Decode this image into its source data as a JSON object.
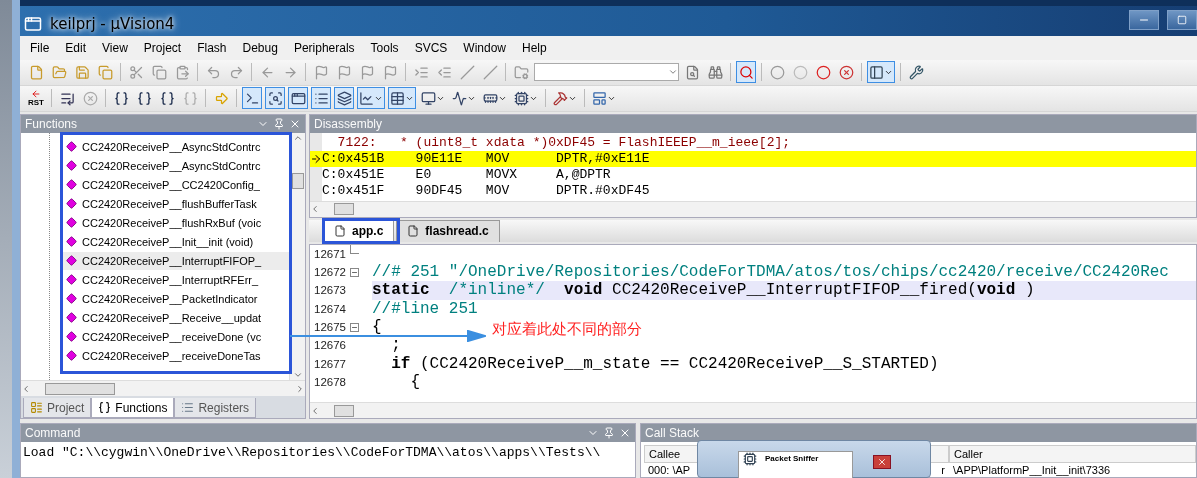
{
  "window": {
    "title": "keilprj  - µVision4"
  },
  "menu": [
    {
      "label": "File"
    },
    {
      "label": "Edit"
    },
    {
      "label": "View"
    },
    {
      "label": "Project"
    },
    {
      "label": "Flash"
    },
    {
      "label": "Debug"
    },
    {
      "label": "Peripherals"
    },
    {
      "label": "Tools"
    },
    {
      "label": "SVCS"
    },
    {
      "label": "Window"
    },
    {
      "label": "Help"
    }
  ],
  "debug_toolbar": {
    "reset_label": "RST",
    "windows": [
      {
        "on": true
      },
      {
        "on": true
      },
      {
        "on": true
      },
      {
        "on": true
      },
      {
        "on": true
      },
      {
        "on": true
      },
      {
        "on": true
      },
      {
        "on": false
      },
      {
        "on": false
      },
      {
        "on": false
      },
      {
        "on": false
      }
    ]
  },
  "functions_panel": {
    "title": "Functions",
    "items": [
      {
        "label": "CC2420ReceiveP__AsyncStdContrc",
        "selected": false
      },
      {
        "label": "CC2420ReceiveP__AsyncStdContrc",
        "selected": false
      },
      {
        "label": "CC2420ReceiveP__CC2420Config_",
        "selected": false
      },
      {
        "label": "CC2420ReceiveP__flushBufferTask",
        "selected": false
      },
      {
        "label": "CC2420ReceiveP__flushRxBuf (voic",
        "selected": false
      },
      {
        "label": "CC2420ReceiveP__Init__init (void)",
        "selected": false
      },
      {
        "label": "CC2420ReceiveP__InterruptFIFOP_",
        "selected": true
      },
      {
        "label": "CC2420ReceiveP__InterruptRFErr_",
        "selected": false
      },
      {
        "label": "CC2420ReceiveP__PacketIndicator",
        "selected": false
      },
      {
        "label": "CC2420ReceiveP__Receive__updat",
        "selected": false
      },
      {
        "label": "CC2420ReceiveP__receiveDone (vc",
        "selected": false
      },
      {
        "label": "CC2420ReceiveP__receiveDoneTas",
        "selected": false
      }
    ],
    "tabs": [
      {
        "label": "Project",
        "selected": false
      },
      {
        "label": "Functions",
        "selected": true
      },
      {
        "label": "Registers",
        "selected": false
      }
    ]
  },
  "disassembly": {
    "title": "Disassembly",
    "lines": [
      {
        "kind": "source",
        "text": "  7122:   * (uint8_t xdata *)0xDF45 = FlashIEEEP__m_ieee[2];",
        "current": false
      },
      {
        "kind": "asm",
        "text": "C:0x451B    90E11E   MOV      DPTR,#0xE11E",
        "current": true
      },
      {
        "kind": "asm",
        "text": "C:0x451E    E0       MOVX     A,@DPTR",
        "current": false
      },
      {
        "kind": "asm",
        "text": "C:0x451F    90DF45   MOV      DPTR.#0xDF45",
        "current": false
      }
    ]
  },
  "editor": {
    "tabs": [
      {
        "label": "app.c",
        "selected": true
      },
      {
        "label": "flashread.c",
        "selected": false
      }
    ],
    "lines": [
      {
        "number": "12671",
        "fold_open": false,
        "fold_end": true,
        "highlighted": false
      },
      {
        "number": "12672",
        "fold_open": true,
        "fold_end": false,
        "highlighted": false,
        "segments": [
          {
            "kind": "comment",
            "text": "//# 251 \"/OneDrive/Repositories/CodeForTDMA/atos/tos/chips/cc2420/receive/CC2420Rec"
          }
        ]
      },
      {
        "number": "12673",
        "fold_open": false,
        "fold_end": false,
        "highlighted": true,
        "segments": [
          {
            "kind": "keyword",
            "text": "static"
          },
          {
            "kind": "comment",
            "text": "  /*inline*/  "
          },
          {
            "kind": "keyword",
            "text": "void"
          },
          {
            "kind": "plain",
            "text": " CC2420ReceiveP__InterruptFIFOP__fired("
          },
          {
            "kind": "keyword",
            "text": "void"
          },
          {
            "kind": "plain",
            "text": " )"
          }
        ]
      },
      {
        "number": "12674",
        "fold_open": false,
        "fold_end": false,
        "highlighted": false,
        "segments": [
          {
            "kind": "comment",
            "text": "//#line 251"
          }
        ]
      },
      {
        "number": "12675",
        "fold_open": true,
        "fold_end": false,
        "highlighted": false,
        "segments": [
          {
            "kind": "plain",
            "text": "{"
          }
        ]
      },
      {
        "number": "12676",
        "fold_open": false,
        "fold_end": false,
        "highlighted": false,
        "segments": [
          {
            "kind": "plain",
            "text": "  ;"
          }
        ]
      },
      {
        "number": "12677",
        "fold_open": false,
        "fold_end": false,
        "highlighted": false,
        "segments": [
          {
            "kind": "keyword",
            "text": "  if"
          },
          {
            "kind": "plain",
            "text": " (CC2420ReceiveP__m_state == CC2420ReceiveP__S_STARTED)"
          }
        ]
      },
      {
        "number": "12678",
        "fold_open": false,
        "fold_end": false,
        "highlighted": false,
        "segments": [
          {
            "kind": "plain",
            "text": "    {"
          }
        ]
      }
    ]
  },
  "annotation": {
    "text": "对应着此处不同的部分"
  },
  "command_panel": {
    "title": "Command",
    "text": "Load \"C:\\\\cygwin\\\\OneDrive\\\\Repositories\\\\CodeForTDMA\\\\atos\\\\apps\\\\Tests\\\\"
  },
  "call_stack": {
    "title": "Call Stack",
    "columns": [
      "Callee",
      "Caller"
    ],
    "rows": [
      {
        "callee": [
          "000: \\AP",
          "r"
        ],
        "caller": "\\APP\\PlatformP__Init__init\\7336"
      }
    ]
  },
  "preview_window": {
    "title": "Packet Sniffer"
  }
}
